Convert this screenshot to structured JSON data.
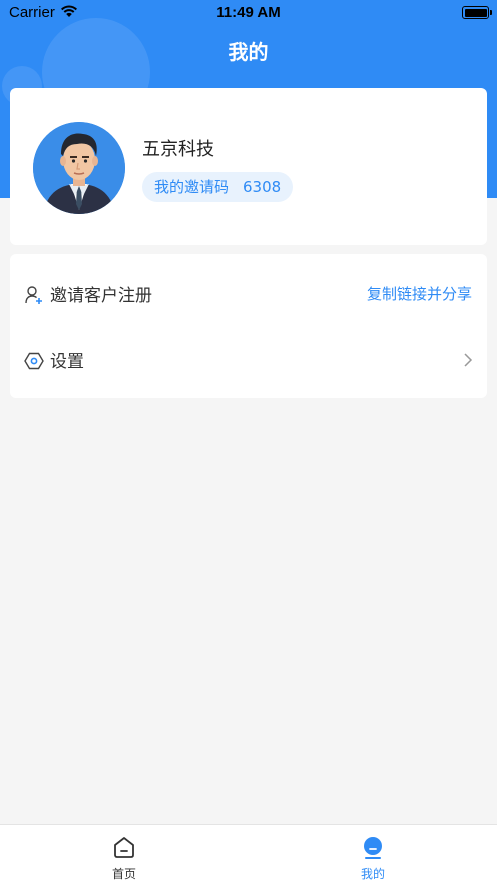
{
  "status_bar": {
    "carrier": "Carrier",
    "time": "11:49 AM"
  },
  "header": {
    "title": "我的"
  },
  "profile": {
    "company_name": "五京科技",
    "invite_label": "我的邀请码",
    "invite_code": "6308"
  },
  "menu": {
    "invite": {
      "label": "邀请客户注册",
      "action": "复制链接并分享",
      "icon": "user-add-icon"
    },
    "settings": {
      "label": "设置",
      "icon": "hexagon-settings-icon"
    }
  },
  "tab_bar": {
    "tabs": [
      {
        "label": "首页",
        "icon": "home-icon",
        "active": false
      },
      {
        "label": "我的",
        "icon": "profile-icon",
        "active": true
      }
    ]
  },
  "colors": {
    "accent": "#2f8bf5",
    "background": "#f5f5f5",
    "badge_bg": "#e8f2fd"
  }
}
